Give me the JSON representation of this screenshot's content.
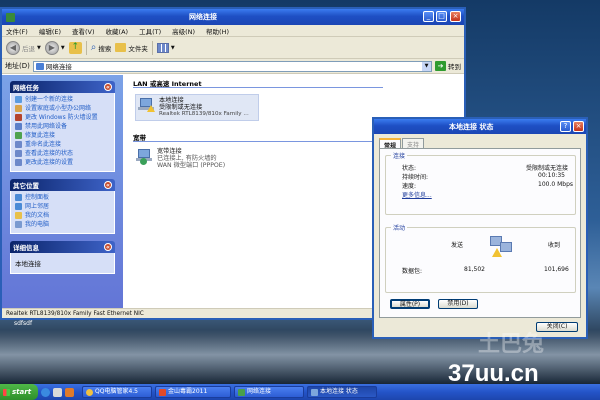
{
  "explorer": {
    "title": "网络连接",
    "menu": [
      "文件(F)",
      "编辑(E)",
      "查看(V)",
      "收藏(A)",
      "工具(T)",
      "高级(N)",
      "帮助(H)"
    ],
    "toolbar": {
      "back": "后退",
      "search": "搜索",
      "folders": "文件夹"
    },
    "address": {
      "label": "地址(D)",
      "value": "网络连接",
      "go": "转到"
    },
    "sidebar": {
      "network_tasks": {
        "title": "网络任务",
        "items": [
          "创建一个新的连接",
          "设置家庭或小型办公网络",
          "更改 Windows 防火墙设置",
          "禁用此网络设备",
          "修复此连接",
          "重命名此连接",
          "查看此连接的状态",
          "更改此连接的设置"
        ]
      },
      "other_places": {
        "title": "其它位置",
        "items": [
          "控制面板",
          "网上邻居",
          "我的文档",
          "我的电脑"
        ]
      },
      "details": {
        "title": "详细信息",
        "body": "本地连接"
      }
    },
    "content": {
      "group_lan": "LAN 或高速 Internet",
      "lan": {
        "name": "本地连接",
        "status": "受限制或无连接",
        "device": "Realtek RTL8139/810x Family ..."
      },
      "group_broadband": "宽带",
      "broadband": {
        "name": "宽带连接",
        "status": "已连接上, 有防火墙的",
        "device": "WAN 微型端口 (PPPOE)"
      }
    },
    "statusbar": "Realtek RTL8139/810x Family Fast Ethernet NIC"
  },
  "dialog": {
    "title": "本地连接 状态",
    "tabs": [
      "常规",
      "支持"
    ],
    "connection": {
      "legend": "连接",
      "status_label": "状态:",
      "status_value": "受限制或无连接",
      "duration_label": "持续时间:",
      "duration_value": "00:10:35",
      "speed_label": "速度:",
      "speed_value": "100.0 Mbps",
      "details_link": "更多信息..."
    },
    "activity": {
      "legend": "活动",
      "sent_label": "发送",
      "received_label": "收到",
      "packets_label": "数据包:",
      "sent_value": "81,502",
      "received_value": "101,696"
    },
    "buttons": {
      "properties": "属性(P)",
      "disable": "禁用(D)",
      "close": "关闭(C)"
    }
  },
  "desktop": {
    "text": "sdfsdf"
  },
  "taskbar": {
    "start": "start",
    "buttons": [
      "QQ电脑管家4.5",
      "金山毒霸2011",
      "网络连接",
      "本地连接 状态"
    ]
  },
  "watermark": {
    "site": "37uu.cn",
    "brand": "土巴兔"
  }
}
